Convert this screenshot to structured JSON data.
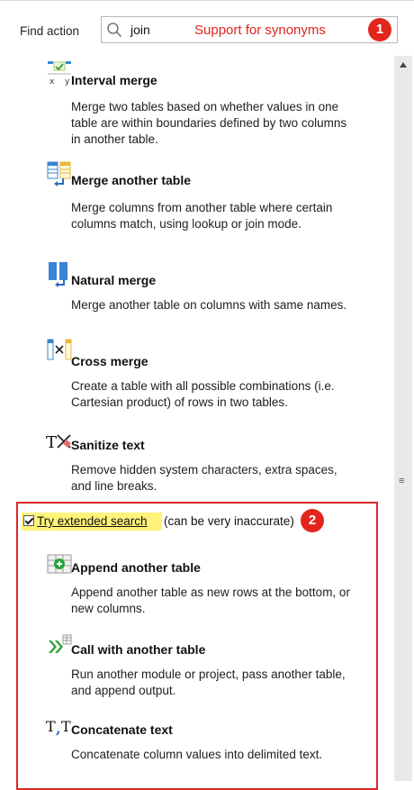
{
  "search": {
    "label": "Find action",
    "value": "join",
    "note": "Support for synonyms"
  },
  "badges": [
    "1",
    "2"
  ],
  "items": [
    {
      "icon": "interval-merge-icon",
      "title": "Interval merge",
      "desc": "Merge two tables based on whether values in one table are within boundaries defined by two columns in another table."
    },
    {
      "icon": "merge-table-icon",
      "title": "Merge another table",
      "desc": "Merge columns from another table where certain columns match, using lookup or join mode."
    },
    {
      "icon": "natural-merge-icon",
      "title": "Natural merge",
      "desc": "Merge another table on columns with same names."
    },
    {
      "icon": "cross-merge-icon",
      "title": "Cross merge",
      "desc": "Create a table with all possible combinations (i.e. Cartesian product) of rows in two tables."
    },
    {
      "icon": "sanitize-text-icon",
      "title": "Sanitize text",
      "desc": "Remove hidden system characters, extra spaces, and line breaks."
    }
  ],
  "extended": {
    "checked": true,
    "label": "Try extended search",
    "note": "(can be very inaccurate)",
    "items": [
      {
        "icon": "append-table-icon",
        "title": "Append another table",
        "desc": "Append another table as new rows at the bottom, or new columns."
      },
      {
        "icon": "call-module-icon",
        "title": "Call with another table",
        "desc": "Run another module or project, pass another table, and append output."
      },
      {
        "icon": "concatenate-text-icon",
        "title": "Concatenate text",
        "desc": "Concatenate column values into delimited text."
      }
    ]
  },
  "colors": {
    "accent_red": "#e3261b",
    "highlight_yellow": "#fff37a",
    "scrollbar": "#e9e9e9"
  }
}
